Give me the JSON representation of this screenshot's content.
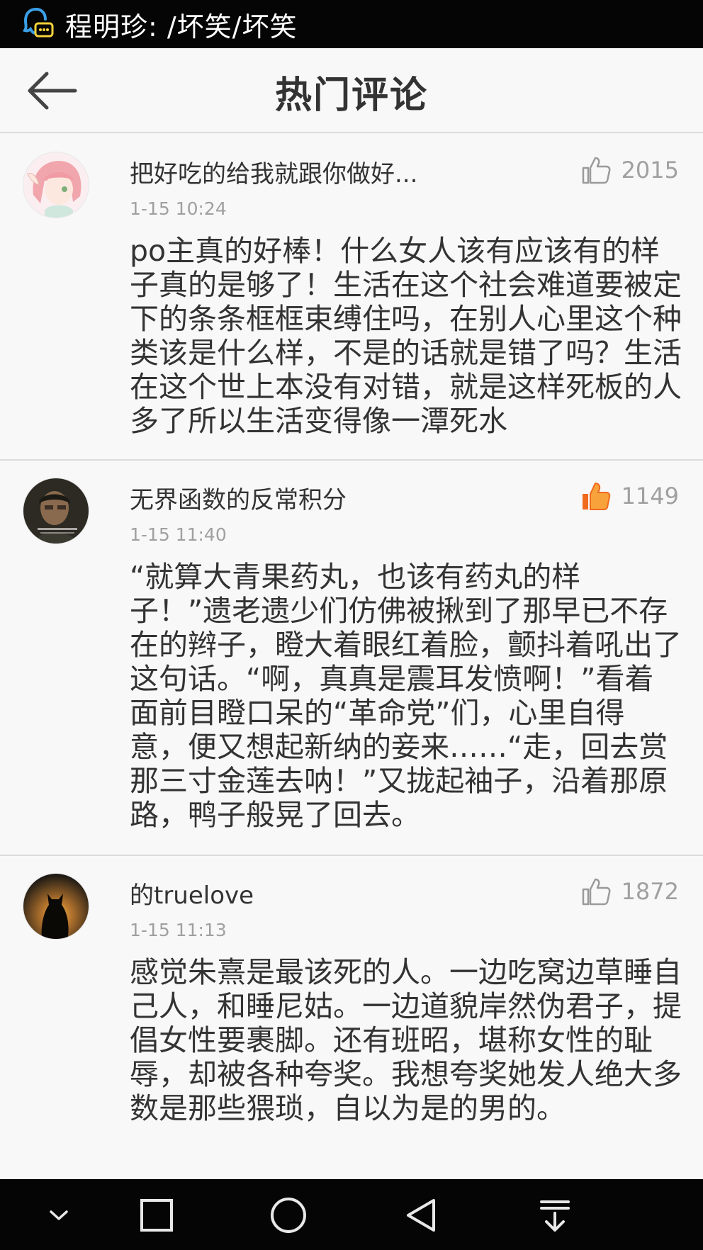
{
  "status_bar": {
    "notification_text": "程明珍: /坏笑/坏笑"
  },
  "header": {
    "title": "热门评论"
  },
  "comments": [
    {
      "username": "把好吃的给我就跟你做好...",
      "time": "1-15 10:24",
      "likes": "2015",
      "liked": false,
      "content": "po主真的好棒！什么女人该有应该有的样子真的是够了！生活在这个社会难道要被定下的条条框框束缚住吗，在别人心里这个种类该是什么样，不是的话就是错了吗？生活在这个世上本没有对错，就是这样死板的人多了所以生活变得像一潭死水",
      "avatar_icon": "anime-girl-avatar"
    },
    {
      "username": "无界函数的反常积分",
      "time": "1-15 11:40",
      "likes": "1149",
      "liked": true,
      "content": "“就算大青果药丸，也该有药丸的样子！”遗老遗少们仿佛被揪到了那早已不存在的辫子，瞪大着眼红着脸，颤抖着吼出了这句话。“啊，真真是震耳发愤啊！”看着面前目瞪口呆的“革命党”们，心里自得意，便又想起新纳的妾来……“走，回去赏那三寸金莲去呐！”又拢起袖子，沿着那原路，鸭子般晃了回去。",
      "avatar_icon": "movie-still-avatar"
    },
    {
      "username": "的truelove",
      "time": "1-15 11:13",
      "likes": "1872",
      "liked": false,
      "content": "感觉朱熹是最该死的人。一边吃窝边草睡自己人，和睡尼姑。一边道貌岸然伪君子，提倡女性要裹脚。还有班昭，堪称女性的耻辱，却被各种夸奖。我想夸奖她发人绝大多数是那些猥琐，自以为是的男的。",
      "avatar_icon": "cat-silhouette-avatar"
    }
  ],
  "colors": {
    "accent_liked": "#f06a1e",
    "text_primary": "#333333",
    "text_secondary": "#a0a0a0",
    "bars": "#050505"
  }
}
